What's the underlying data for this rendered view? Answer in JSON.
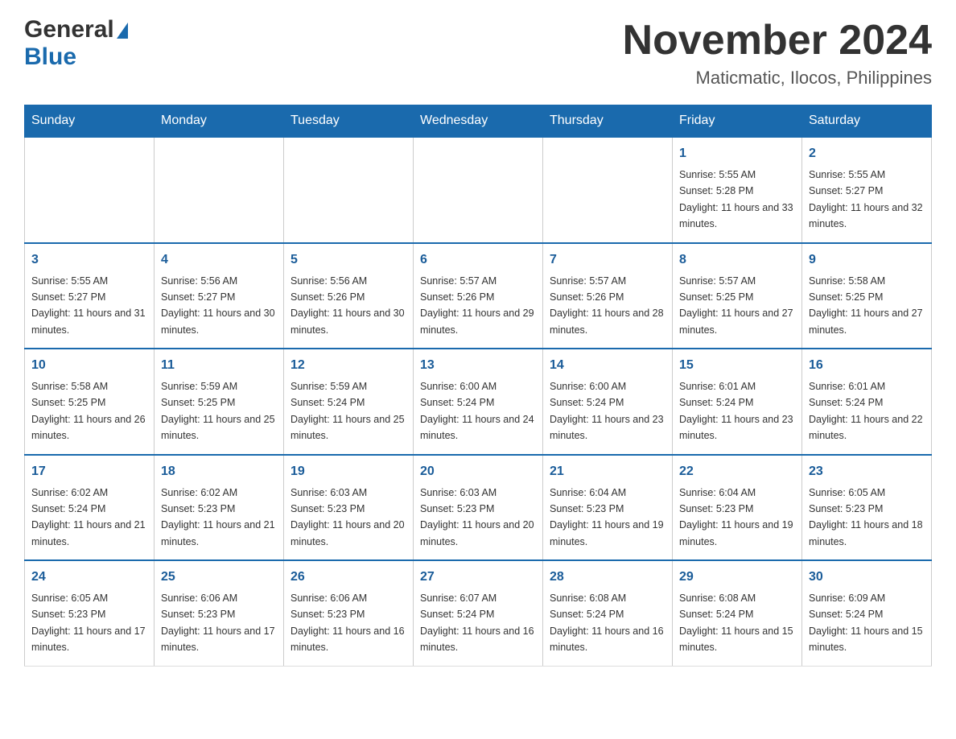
{
  "header": {
    "logo_general": "General",
    "logo_blue": "Blue",
    "title": "November 2024",
    "subtitle": "Maticmatic, Ilocos, Philippines"
  },
  "days_of_week": [
    "Sunday",
    "Monday",
    "Tuesday",
    "Wednesday",
    "Thursday",
    "Friday",
    "Saturday"
  ],
  "weeks": [
    [
      {
        "day": "",
        "info": ""
      },
      {
        "day": "",
        "info": ""
      },
      {
        "day": "",
        "info": ""
      },
      {
        "day": "",
        "info": ""
      },
      {
        "day": "",
        "info": ""
      },
      {
        "day": "1",
        "info": "Sunrise: 5:55 AM\nSunset: 5:28 PM\nDaylight: 11 hours and 33 minutes."
      },
      {
        "day": "2",
        "info": "Sunrise: 5:55 AM\nSunset: 5:27 PM\nDaylight: 11 hours and 32 minutes."
      }
    ],
    [
      {
        "day": "3",
        "info": "Sunrise: 5:55 AM\nSunset: 5:27 PM\nDaylight: 11 hours and 31 minutes."
      },
      {
        "day": "4",
        "info": "Sunrise: 5:56 AM\nSunset: 5:27 PM\nDaylight: 11 hours and 30 minutes."
      },
      {
        "day": "5",
        "info": "Sunrise: 5:56 AM\nSunset: 5:26 PM\nDaylight: 11 hours and 30 minutes."
      },
      {
        "day": "6",
        "info": "Sunrise: 5:57 AM\nSunset: 5:26 PM\nDaylight: 11 hours and 29 minutes."
      },
      {
        "day": "7",
        "info": "Sunrise: 5:57 AM\nSunset: 5:26 PM\nDaylight: 11 hours and 28 minutes."
      },
      {
        "day": "8",
        "info": "Sunrise: 5:57 AM\nSunset: 5:25 PM\nDaylight: 11 hours and 27 minutes."
      },
      {
        "day": "9",
        "info": "Sunrise: 5:58 AM\nSunset: 5:25 PM\nDaylight: 11 hours and 27 minutes."
      }
    ],
    [
      {
        "day": "10",
        "info": "Sunrise: 5:58 AM\nSunset: 5:25 PM\nDaylight: 11 hours and 26 minutes."
      },
      {
        "day": "11",
        "info": "Sunrise: 5:59 AM\nSunset: 5:25 PM\nDaylight: 11 hours and 25 minutes."
      },
      {
        "day": "12",
        "info": "Sunrise: 5:59 AM\nSunset: 5:24 PM\nDaylight: 11 hours and 25 minutes."
      },
      {
        "day": "13",
        "info": "Sunrise: 6:00 AM\nSunset: 5:24 PM\nDaylight: 11 hours and 24 minutes."
      },
      {
        "day": "14",
        "info": "Sunrise: 6:00 AM\nSunset: 5:24 PM\nDaylight: 11 hours and 23 minutes."
      },
      {
        "day": "15",
        "info": "Sunrise: 6:01 AM\nSunset: 5:24 PM\nDaylight: 11 hours and 23 minutes."
      },
      {
        "day": "16",
        "info": "Sunrise: 6:01 AM\nSunset: 5:24 PM\nDaylight: 11 hours and 22 minutes."
      }
    ],
    [
      {
        "day": "17",
        "info": "Sunrise: 6:02 AM\nSunset: 5:24 PM\nDaylight: 11 hours and 21 minutes."
      },
      {
        "day": "18",
        "info": "Sunrise: 6:02 AM\nSunset: 5:23 PM\nDaylight: 11 hours and 21 minutes."
      },
      {
        "day": "19",
        "info": "Sunrise: 6:03 AM\nSunset: 5:23 PM\nDaylight: 11 hours and 20 minutes."
      },
      {
        "day": "20",
        "info": "Sunrise: 6:03 AM\nSunset: 5:23 PM\nDaylight: 11 hours and 20 minutes."
      },
      {
        "day": "21",
        "info": "Sunrise: 6:04 AM\nSunset: 5:23 PM\nDaylight: 11 hours and 19 minutes."
      },
      {
        "day": "22",
        "info": "Sunrise: 6:04 AM\nSunset: 5:23 PM\nDaylight: 11 hours and 19 minutes."
      },
      {
        "day": "23",
        "info": "Sunrise: 6:05 AM\nSunset: 5:23 PM\nDaylight: 11 hours and 18 minutes."
      }
    ],
    [
      {
        "day": "24",
        "info": "Sunrise: 6:05 AM\nSunset: 5:23 PM\nDaylight: 11 hours and 17 minutes."
      },
      {
        "day": "25",
        "info": "Sunrise: 6:06 AM\nSunset: 5:23 PM\nDaylight: 11 hours and 17 minutes."
      },
      {
        "day": "26",
        "info": "Sunrise: 6:06 AM\nSunset: 5:23 PM\nDaylight: 11 hours and 16 minutes."
      },
      {
        "day": "27",
        "info": "Sunrise: 6:07 AM\nSunset: 5:24 PM\nDaylight: 11 hours and 16 minutes."
      },
      {
        "day": "28",
        "info": "Sunrise: 6:08 AM\nSunset: 5:24 PM\nDaylight: 11 hours and 16 minutes."
      },
      {
        "day": "29",
        "info": "Sunrise: 6:08 AM\nSunset: 5:24 PM\nDaylight: 11 hours and 15 minutes."
      },
      {
        "day": "30",
        "info": "Sunrise: 6:09 AM\nSunset: 5:24 PM\nDaylight: 11 hours and 15 minutes."
      }
    ]
  ]
}
